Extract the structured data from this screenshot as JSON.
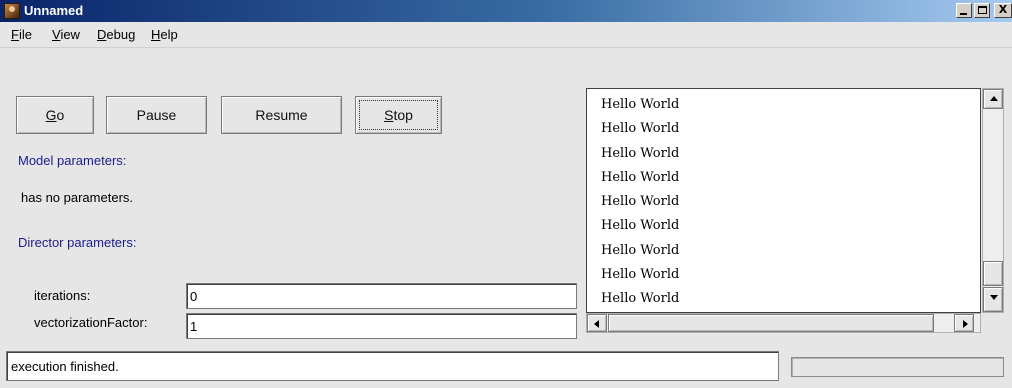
{
  "window": {
    "title": "Unnamed",
    "icon": "ptolemy-app-icon",
    "controls": {
      "minimize": "minimize-icon",
      "maximize": "maximize-icon",
      "close": "X"
    }
  },
  "menu": {
    "items": [
      {
        "label_u": "F",
        "label_rest": "ile"
      },
      {
        "label_u": "V",
        "label_rest": "iew"
      },
      {
        "label_u": "D",
        "label_rest": "ebug"
      },
      {
        "label_u": "H",
        "label_rest": "elp"
      }
    ]
  },
  "controls": {
    "go": {
      "label_u": "G",
      "label_rest": "o"
    },
    "pause": "Pause",
    "resume": "Resume",
    "stop": {
      "label_u": "S",
      "label_rest": "top"
    }
  },
  "model": {
    "heading": "Model parameters:",
    "none_text": "has no parameters."
  },
  "director": {
    "heading": "Director parameters:",
    "params": [
      {
        "label": "iterations:",
        "value": "0"
      },
      {
        "label": "vectorizationFactor:",
        "value": "1"
      }
    ]
  },
  "output": {
    "lines": [
      "Hello World",
      "Hello World",
      "Hello World",
      "Hello World",
      "Hello World",
      "Hello World",
      "Hello World",
      "Hello World",
      "Hello World"
    ],
    "vertical_scroll_fraction": 1.0,
    "horizontal_scroll_fraction": 0.0
  },
  "status": {
    "message": "execution finished.",
    "progress": 0
  },
  "colors": {
    "accent_label": "#1c1c8c",
    "titlebar_start": "#0a246a",
    "titlebar_end": "#a6caf0",
    "panel_bg": "#e6e6e6"
  }
}
